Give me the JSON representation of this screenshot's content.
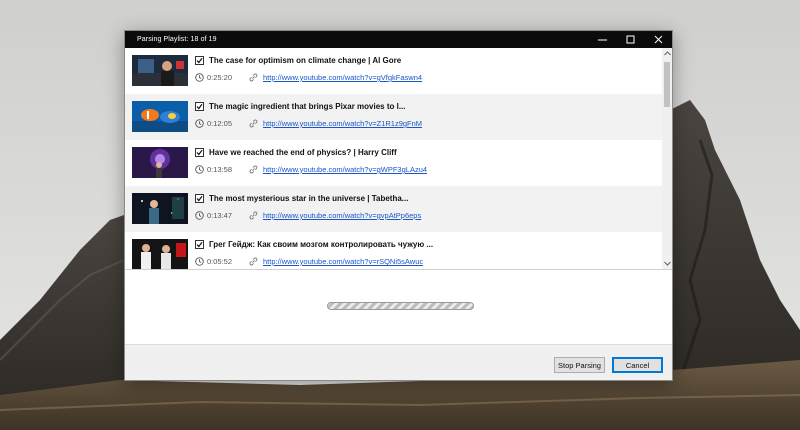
{
  "window": {
    "title": "Parsing Playlist: 18 of 19",
    "minimize_label": "—",
    "maximize_label": "☐",
    "close_label": "✕"
  },
  "items": [
    {
      "title": "The case for optimism on climate change | Al Gore",
      "duration": "0:25:20",
      "url": "http://www.youtube.com/watch?v=gVfgkFaswn4",
      "checked": true
    },
    {
      "title": "The magic ingredient that brings Pixar movies to l...",
      "duration": "0:12:05",
      "url": "http://www.youtube.com/watch?v=Z1R1z9gFnM",
      "checked": true
    },
    {
      "title": "Have we reached the end of physics? | Harry Cliff",
      "duration": "0:13:58",
      "url": "http://www.youtube.com/watch?v=gWPF3gLAzu4",
      "checked": true
    },
    {
      "title": "The most mysterious star in the universe | Tabetha...",
      "duration": "0:13:47",
      "url": "http://www.youtube.com/watch?v=gvpAtPp6eps",
      "checked": true
    },
    {
      "title": "Грег Гейдж: Как своим мозгом контролировать чужую ...",
      "duration": "0:05:52",
      "url": "http://www.youtube.com/watch?v=rSQNi5sAwuc",
      "checked": true
    }
  ],
  "buttons": {
    "stop_label": "Stop Parsing",
    "cancel_label": "Cancel"
  },
  "colors": {
    "titlebar": "#0b0b0b",
    "link": "#1a56c8",
    "focus_border": "#0078d7"
  }
}
